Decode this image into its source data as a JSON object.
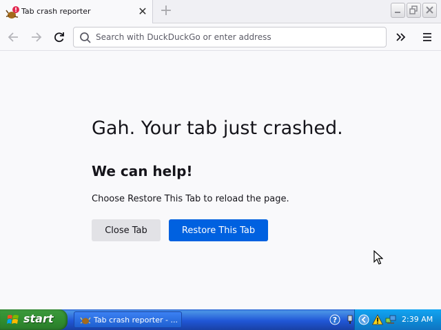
{
  "window": {
    "tab_title": "Tab crash reporter",
    "new_tab_label": "+",
    "close_tab_glyph": "✕"
  },
  "navbar": {
    "url_placeholder": "Search with DuckDuckGo or enter address"
  },
  "content": {
    "title": "Gah. Your tab just crashed.",
    "subtitle": "We can help!",
    "description": "Choose Restore This Tab to reload the page.",
    "close_tab_label": "Close Tab",
    "restore_tab_label": "Restore This Tab"
  },
  "taskbar": {
    "start_label": "start",
    "task_label": "Tab crash reporter - ...",
    "clock": "2:39 AM"
  },
  "colors": {
    "primary_button": "#0061e0",
    "secondary_button": "#e2e2e6",
    "page_background": "#f9f9fb"
  },
  "icons": [
    "crash-bug-icon",
    "close-icon",
    "plus-icon",
    "minimize-icon",
    "maximize-icon",
    "window-close-icon",
    "back-arrow-icon",
    "forward-arrow-icon",
    "reload-icon",
    "search-icon",
    "overflow-chevron-icon",
    "menu-icon",
    "windows-logo-icon",
    "help-icon",
    "safely-remove-icon",
    "collapse-tray-icon",
    "warning-icon",
    "network-icon",
    "mouse-pointer-icon"
  ]
}
